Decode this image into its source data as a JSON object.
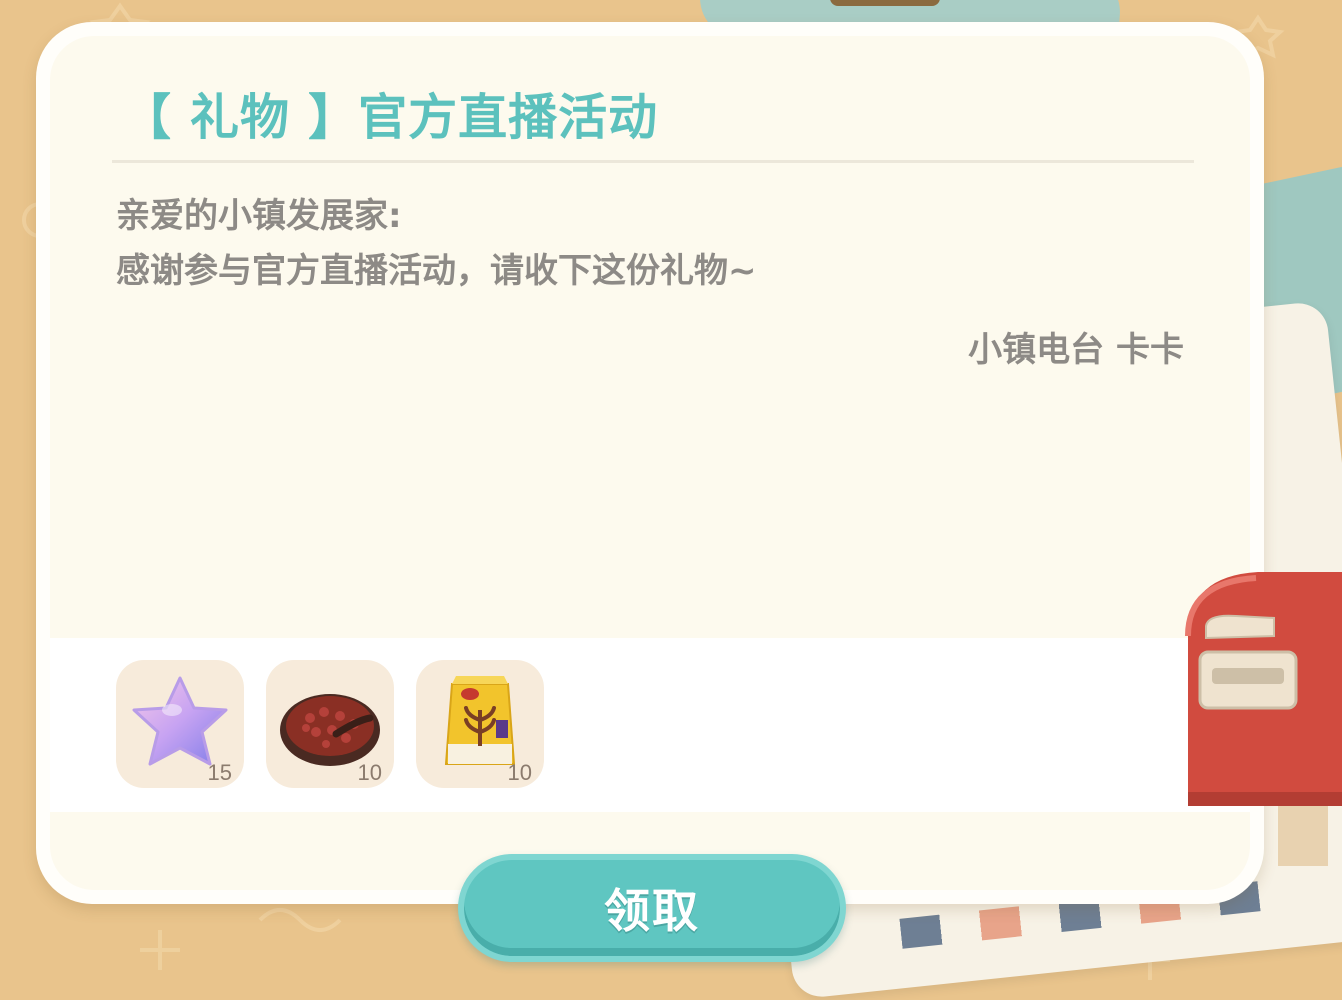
{
  "mail": {
    "title": "【 礼物 】官方直播活动",
    "greeting": "亲爱的小镇发展家:",
    "body": "感谢参与官方直播活动，请收下这份礼物~",
    "signature": "小镇电台 卡卡"
  },
  "rewards": [
    {
      "icon": "star-icon",
      "count": "15"
    },
    {
      "icon": "bean-bowl-icon",
      "count": "10"
    },
    {
      "icon": "flour-bag-icon",
      "count": "10"
    }
  ],
  "actions": {
    "claim_label": "领取"
  },
  "colors": {
    "accent": "#5fc6c1",
    "title": "#5cc1bd",
    "text": "#8d8a86",
    "background": "#e9c48c"
  }
}
